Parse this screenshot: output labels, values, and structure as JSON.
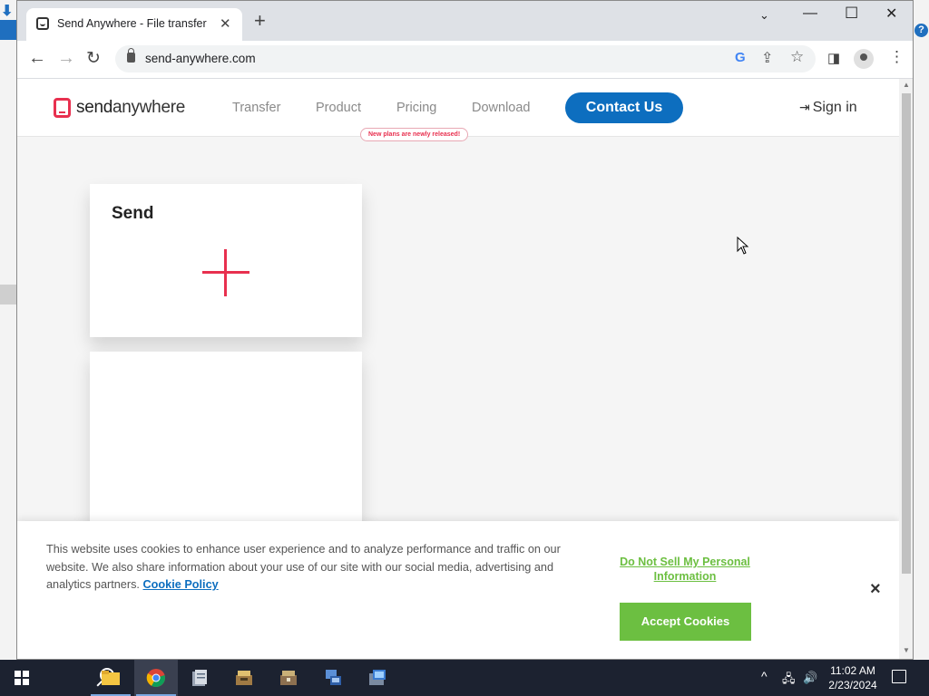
{
  "browser": {
    "tab_title": "Send Anywhere - File transfer",
    "new_tab": "+",
    "url": "send-anywhere.com"
  },
  "site": {
    "logo": {
      "bold": "send",
      "rest": "anywhere"
    },
    "nav": [
      "Transfer",
      "Product",
      "Pricing",
      "Download"
    ],
    "badge": "New plans are newly released!",
    "contact": "Contact Us",
    "signin": "Sign in"
  },
  "main": {
    "send_card_title": "Send"
  },
  "cookie": {
    "text": "This website uses cookies to enhance user experience and to analyze performance and traffic on our website. We also share information about your use of our site with our social media, advertising and analytics partners.",
    "policy_link": "Cookie Policy",
    "do_not_sell": "Do Not Sell My Personal Information",
    "accept": "Accept Cookies",
    "close": "×"
  },
  "taskbar": {
    "time": "11:02 AM",
    "date": "2/23/2024"
  },
  "colors": {
    "brand_red": "#e8304f",
    "brand_blue": "#0d6ebf",
    "accept_green": "#6cbf41"
  }
}
